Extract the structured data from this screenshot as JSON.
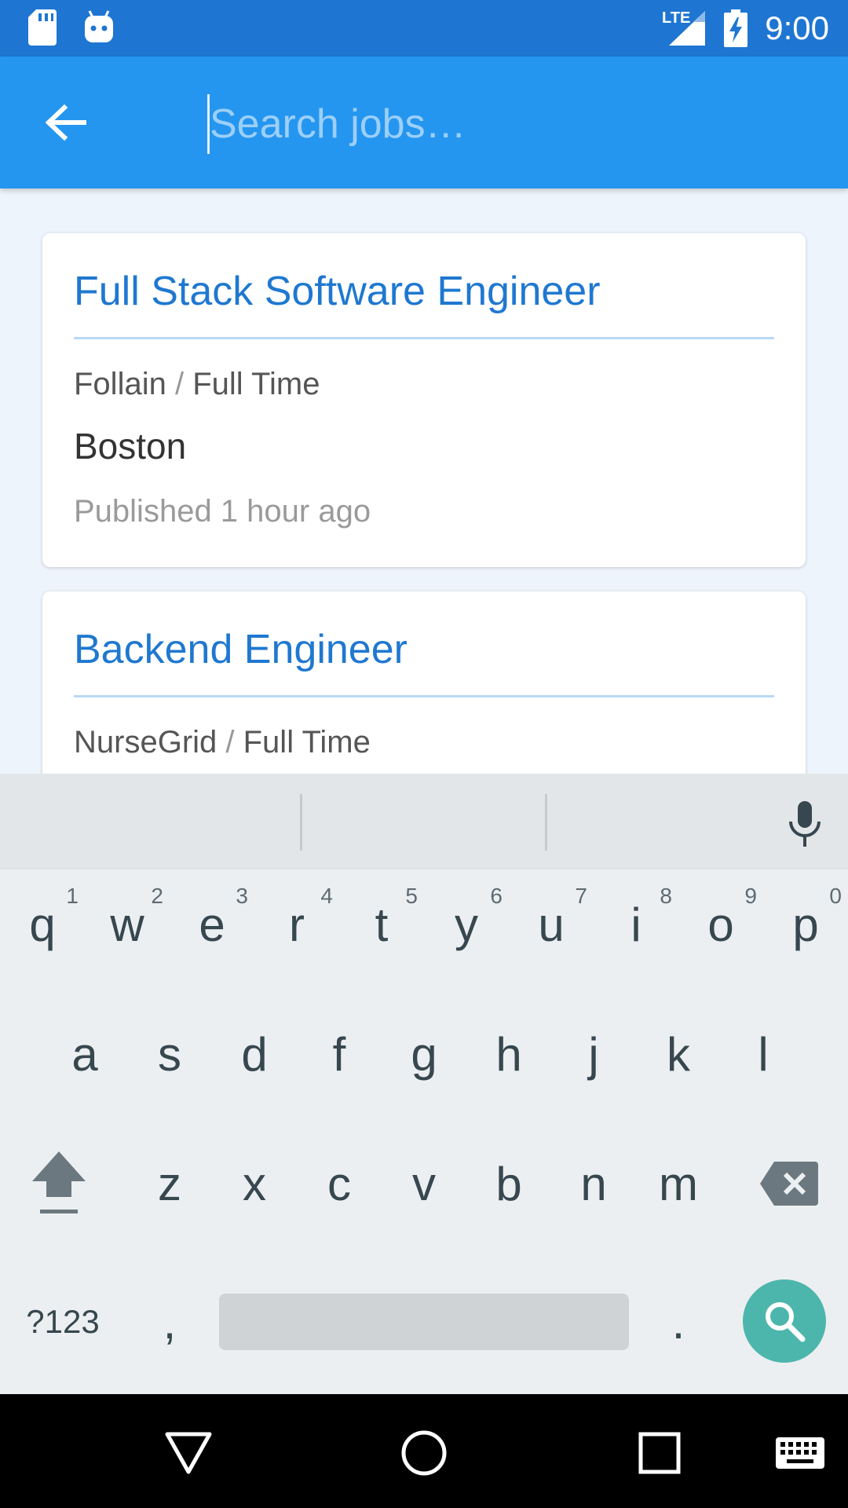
{
  "status_bar": {
    "time": "9:00",
    "network": "LTE",
    "icons": [
      "sd-card-icon",
      "android-icon",
      "lte-signal-icon",
      "battery-charging-icon"
    ]
  },
  "app_bar": {
    "back_icon": "arrow-left-icon",
    "search_placeholder": "Search jobs…",
    "search_value": ""
  },
  "jobs": [
    {
      "title": "Full Stack Software Engineer",
      "company": "Follain",
      "type": "Full Time",
      "location": "Boston",
      "published": "Published 1 hour ago"
    },
    {
      "title": "Backend Engineer",
      "company": "NurseGrid",
      "type": "Full Time"
    }
  ],
  "separator": "/",
  "keyboard": {
    "row1": [
      {
        "key": "q",
        "hint": "1"
      },
      {
        "key": "w",
        "hint": "2"
      },
      {
        "key": "e",
        "hint": "3"
      },
      {
        "key": "r",
        "hint": "4"
      },
      {
        "key": "t",
        "hint": "5"
      },
      {
        "key": "y",
        "hint": "6"
      },
      {
        "key": "u",
        "hint": "7"
      },
      {
        "key": "i",
        "hint": "8"
      },
      {
        "key": "o",
        "hint": "9"
      },
      {
        "key": "p",
        "hint": "0"
      }
    ],
    "row2": [
      "a",
      "s",
      "d",
      "f",
      "g",
      "h",
      "j",
      "k",
      "l"
    ],
    "row3": [
      "z",
      "x",
      "c",
      "v",
      "b",
      "n",
      "m"
    ],
    "symbols_label": "?123",
    "comma": ",",
    "period": ".",
    "accent": "#4db6ac"
  },
  "colors": {
    "status_bar": "#1e76d2",
    "app_bar": "#2496f0",
    "title_blue": "#1f78d0"
  }
}
